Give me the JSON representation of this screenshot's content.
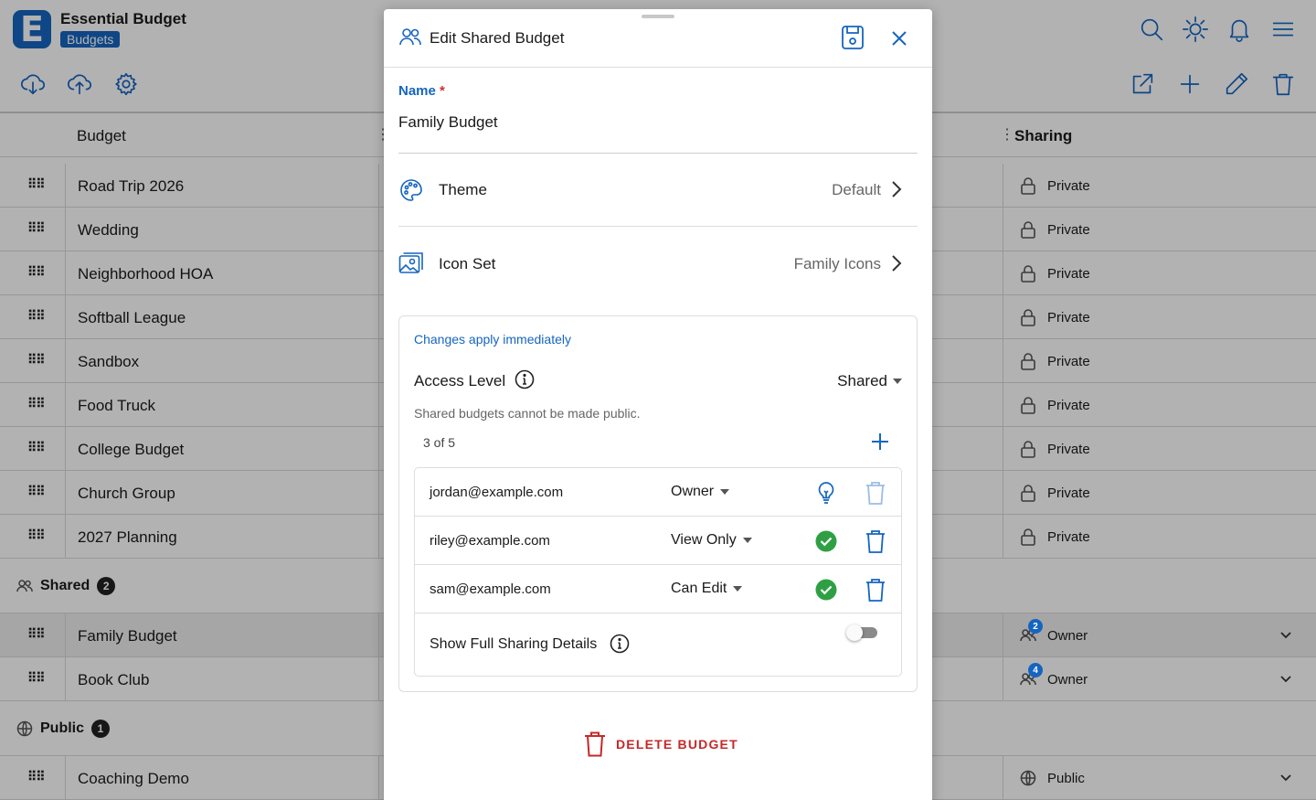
{
  "app": {
    "title": "Essential Budget",
    "badge": "Budgets",
    "logo_letter": "E",
    "accent": "#1565c0"
  },
  "toolbar": {
    "left_icons": [
      "cloud-download-icon",
      "cloud-upload-icon",
      "gear-icon"
    ],
    "right_icons": [
      "search-icon",
      "sun-icon",
      "bell-icon",
      "menu-icon"
    ],
    "action_icons": [
      "external-link-icon",
      "plus-icon",
      "pencil-icon",
      "trash-icon"
    ]
  },
  "table": {
    "columns": {
      "budget": "Budget",
      "sharing": "Sharing"
    },
    "private_rows": [
      {
        "name": "Road Trip 2026",
        "sharing": "Private"
      },
      {
        "name": "Wedding",
        "sharing": "Private"
      },
      {
        "name": "Neighborhood HOA",
        "sharing": "Private"
      },
      {
        "name": "Softball League",
        "sharing": "Private"
      },
      {
        "name": "Sandbox",
        "sharing": "Private"
      },
      {
        "name": "Food Truck",
        "sharing": "Private"
      },
      {
        "name": "College Budget",
        "sharing": "Private"
      },
      {
        "name": "Church Group",
        "sharing": "Private"
      },
      {
        "name": "2027 Planning",
        "sharing": "Private"
      }
    ],
    "shared_group": {
      "label": "Shared",
      "count": "2"
    },
    "shared_rows": [
      {
        "name": "Family Budget",
        "sharing": "Owner",
        "members": "2"
      },
      {
        "name": "Book Club",
        "sharing": "Owner",
        "members": "4"
      }
    ],
    "public_group": {
      "label": "Public",
      "count": "1"
    },
    "public_rows": [
      {
        "name": "Coaching Demo",
        "sharing": "Public"
      }
    ]
  },
  "modal": {
    "title": "Edit Shared Budget",
    "name_label": "Name",
    "required_mark": "*",
    "name_value": "Family Budget",
    "theme": {
      "label": "Theme",
      "value": "Default"
    },
    "icon_set": {
      "label": "Icon Set",
      "value": "Family Icons"
    },
    "sharing": {
      "notice": "Changes apply immediately",
      "access_label": "Access Level",
      "access_value": "Shared",
      "hint": "Shared budgets cannot be made public.",
      "count": "3 of 5",
      "members": [
        {
          "email": "jordan@example.com",
          "role": "Owner",
          "status": "bulb-icon"
        },
        {
          "email": "riley@example.com",
          "role": "View Only",
          "status": "check-circle-icon"
        },
        {
          "email": "sam@example.com",
          "role": "Can Edit",
          "status": "check-circle-icon"
        }
      ],
      "full_details_label": "Show Full Sharing Details",
      "full_details_on": false
    },
    "delete_label": "DELETE BUDGET",
    "colors": {
      "danger": "#c62828",
      "success": "#2ea043"
    }
  }
}
